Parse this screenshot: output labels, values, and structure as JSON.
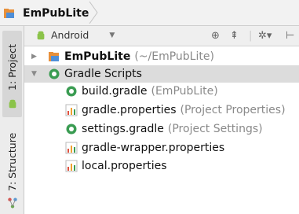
{
  "breadcrumb": {
    "label": "EmPubLite"
  },
  "side_tabs": {
    "project": "1: Project",
    "structure": "7: Structure"
  },
  "toolbar": {
    "view_mode": "Android"
  },
  "tree": {
    "root": {
      "name": "EmPubLite",
      "path": "(~/EmPubLite)"
    },
    "gradle_scripts": {
      "label": "Gradle Scripts"
    },
    "files": [
      {
        "name": "build.gradle",
        "detail": "(EmPubLite)",
        "icon": "gradle-icon"
      },
      {
        "name": "gradle.properties",
        "detail": "(Project Properties)",
        "icon": "properties-icon"
      },
      {
        "name": "settings.gradle",
        "detail": "(Project Settings)",
        "icon": "gradle-icon"
      },
      {
        "name": "gradle-wrapper.properties",
        "detail": "",
        "icon": "properties-icon"
      },
      {
        "name": "local.properties",
        "detail": "",
        "icon": "properties-icon"
      }
    ]
  },
  "colors": {
    "folder": "#e8903a",
    "gradle": "#3a9c52",
    "android": "#8bc34a",
    "selection": "#dcdcdc"
  }
}
